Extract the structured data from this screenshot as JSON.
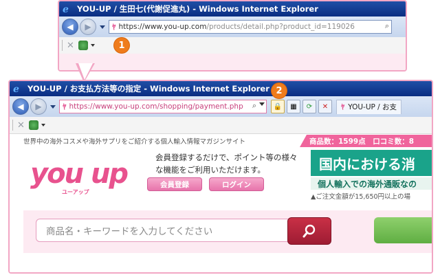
{
  "window1": {
    "title": "YOU-UP / 生田七(代謝促進丸) - Windows Internet Explorer",
    "url_host": "https://www.you-up.com",
    "url_path": "/products/detail.php?product_id=119026"
  },
  "window2": {
    "title": "YOU-UP / お支払方法等の指定 - Windows Internet Explorer",
    "url_host": "https://www.you-up.com",
    "url_path": "/shopping/payment.php",
    "tab_label": "YOU-UP / お支"
  },
  "badges": {
    "one": "1",
    "two": "2"
  },
  "site": {
    "tagline": "世界中の海外コスメや海外サプリをご紹介する個人輸入情報マガジンサイト",
    "counts": "商品数：1599点　口コミ数：8",
    "logo_main": "you up",
    "logo_sub": "ユーアップ",
    "description": "会員登録するだけで、ポイント等の様々な機能をご利用いただけます。",
    "register_button": "会員登録",
    "login_button": "ログイン",
    "banner_heading": "国内における消",
    "banner_sub": "個人輸入での海外通販なの",
    "banner_note": "▲ご注文金額が15,650円以上の場",
    "search_placeholder": "商品名・キーワードを入力してください"
  },
  "colors": {
    "accent_pink": "#e8528e",
    "badge_orange": "#ef7c1c",
    "banner_green": "#1aa38a"
  }
}
